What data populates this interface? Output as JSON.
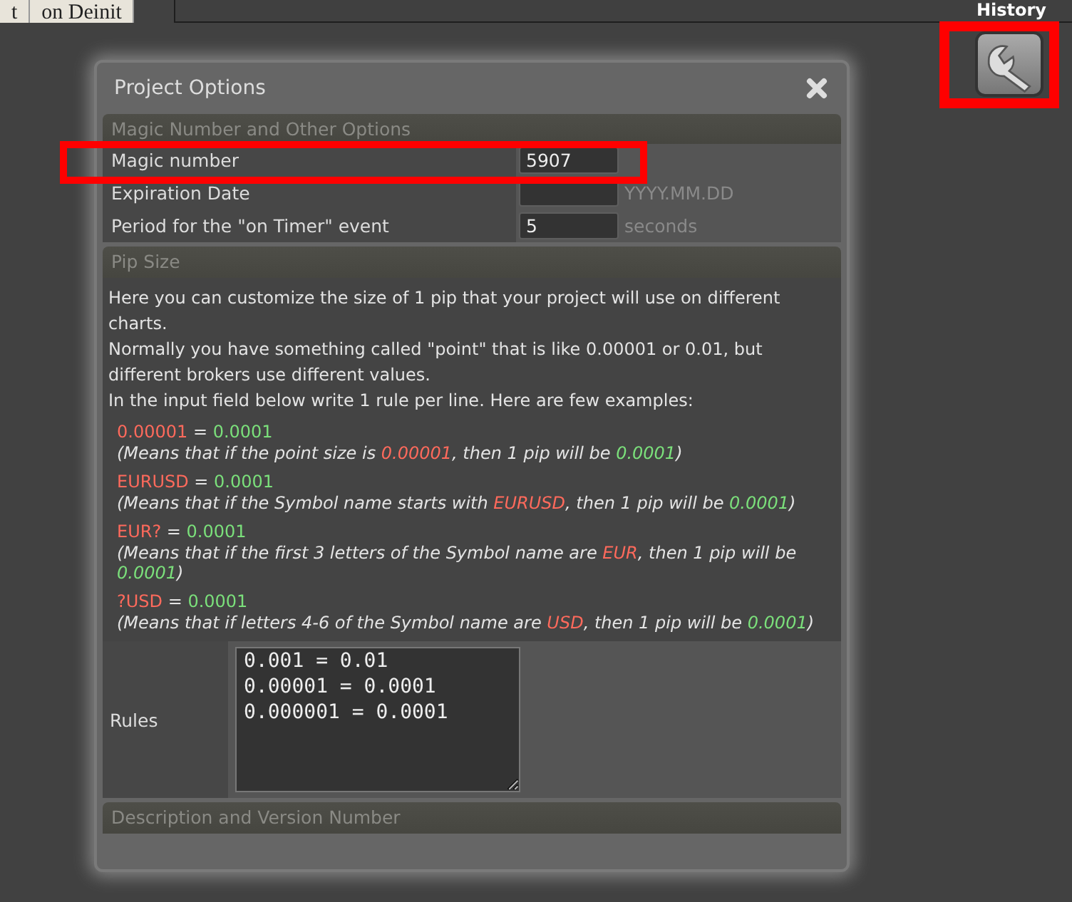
{
  "top_tabs": [
    {
      "label": "t",
      "selected": false
    },
    {
      "label": "on Deinit",
      "selected": false
    }
  ],
  "history_label": "History",
  "dialog": {
    "title": "Project Options",
    "sections": [
      {
        "kind": "form",
        "title": "Magic Number and Other Options",
        "rows": [
          {
            "label": "Magic number",
            "value": "5907",
            "placeholder": "",
            "suffix": ""
          },
          {
            "label": "Expiration Date",
            "value": "",
            "placeholder": "",
            "suffix": "YYYY.MM.DD"
          },
          {
            "label": "Period for the \"on Timer\" event",
            "value": "5",
            "placeholder": "",
            "suffix": "seconds"
          }
        ]
      },
      {
        "kind": "pip",
        "title": "Pip Size",
        "intro": [
          "Here you can customize the size of 1 pip that your project will use on different charts.",
          "Normally you have something called \"point\" that is like 0.00001 or 0.01, but different brokers use different values.",
          "In the input field below write 1 rule per line. Here are few examples:"
        ],
        "examples": [
          {
            "key": "0.00001",
            "sign": " = ",
            "value": "0.0001",
            "note": [
              {
                "kind": "plain",
                "text": "(Means that if the point size is "
              },
              {
                "kind": "key",
                "text": "0.00001"
              },
              {
                "kind": "plain",
                "text": ", then 1 pip will be "
              },
              {
                "kind": "value",
                "text": "0.0001"
              },
              {
                "kind": "plain",
                "text": ")"
              }
            ]
          },
          {
            "key": "EURUSD",
            "sign": " = ",
            "value": "0.0001",
            "note": [
              {
                "kind": "plain",
                "text": "(Means that if the Symbol name starts with "
              },
              {
                "kind": "key",
                "text": "EURUSD"
              },
              {
                "kind": "plain",
                "text": ", then 1 pip will be "
              },
              {
                "kind": "value",
                "text": "0.0001"
              },
              {
                "kind": "plain",
                "text": ")"
              }
            ]
          },
          {
            "key": "EUR?",
            "sign": " = ",
            "value": "0.0001",
            "note": [
              {
                "kind": "plain",
                "text": "(Means that if the first 3 letters of the Symbol name are "
              },
              {
                "kind": "key",
                "text": "EUR"
              },
              {
                "kind": "plain",
                "text": ", then 1 pip will be "
              },
              {
                "kind": "value",
                "text": "0.0001"
              },
              {
                "kind": "plain",
                "text": ")"
              }
            ]
          },
          {
            "key": "?USD",
            "sign": " = ",
            "value": "0.0001",
            "note": [
              {
                "kind": "plain",
                "text": "(Means that if letters 4-6 of the Symbol name are "
              },
              {
                "kind": "key",
                "text": "USD"
              },
              {
                "kind": "plain",
                "text": ", then 1 pip will be "
              },
              {
                "kind": "value",
                "text": "0.0001"
              },
              {
                "kind": "plain",
                "text": ")"
              }
            ]
          }
        ],
        "rules_label": "Rules",
        "rules_value": "0.001 = 0.01\n0.00001 = 0.0001\n0.000001 = 0.0001"
      },
      {
        "kind": "collapsed",
        "title": "Description and Version Number"
      }
    ]
  }
}
